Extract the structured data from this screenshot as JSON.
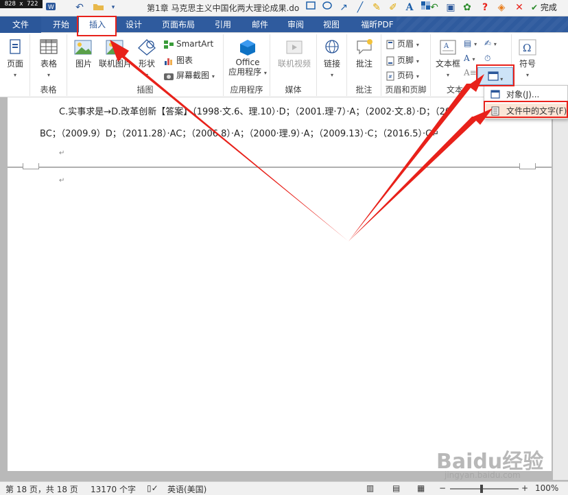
{
  "size_badge": "828 x 722",
  "window": {
    "title": "第1章 马克思主义中国化两大理论成果.do",
    "done_label": "完成"
  },
  "tabs": {
    "file": "文件",
    "items": [
      "开始",
      "插入",
      "设计",
      "页面布局",
      "引用",
      "邮件",
      "审阅",
      "视图",
      "福昕PDF"
    ],
    "active": "插入"
  },
  "ribbon": {
    "pages": {
      "page": "页面",
      "label": ""
    },
    "tables": {
      "table": "表格",
      "label": "表格"
    },
    "illustrations": {
      "picture": "图片",
      "online_picture": "联机图片",
      "shapes": "形状",
      "smartart": "SmartArt",
      "chart": "图表",
      "screenshot": "屏幕截图",
      "label": "插图"
    },
    "apps": {
      "office_apps_line1": "Office",
      "office_apps_line2": "应用程序",
      "label": "应用程序"
    },
    "media": {
      "online_video": "联机视频",
      "label": "媒体"
    },
    "links": {
      "link": "链接"
    },
    "comments": {
      "comment": "批注",
      "label": "批注"
    },
    "header_footer": {
      "header": "页眉",
      "footer": "页脚",
      "page_number": "页码",
      "label": "页眉和页脚"
    },
    "text": {
      "textbox": "文本框",
      "label": "文本"
    },
    "symbols": {
      "symbol": "符号"
    }
  },
  "object_menu": {
    "items": [
      {
        "label": "对象(J)..."
      },
      {
        "label": "文件中的文字(F)..."
      }
    ],
    "highlighted_index": 1
  },
  "document": {
    "line1": "C.实事求是→D.改革创新【答案】（1998·文.6、理.10）·D；（2001.理·7）·A；（2002·文.8）·D；（20",
    "line2": "BC；（2009.9）D；（2011.28）·AC；（2006.8）·A；（2000·理.9）·A；（2009.13）·C；（2016.5）·C↵",
    "para_mark": "↵"
  },
  "status": {
    "page": "第 18 页，共 18 页",
    "words": "13170 个字",
    "language": "英语(美国)",
    "zoom": "100%"
  },
  "watermark": {
    "brand": "Baidu经验",
    "url": "jingyan.baidu.com"
  },
  "colors": {
    "tab_bar": "#2f5b9e",
    "annotation_red": "#e8211a",
    "menu_highlight": "#fbe5d6"
  }
}
